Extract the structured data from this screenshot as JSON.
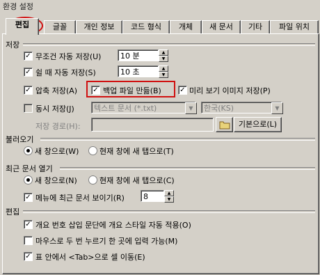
{
  "window": {
    "title": "환경 설정"
  },
  "tabs": [
    "편집",
    "글꼴",
    "개인 정보",
    "코드 형식",
    "개체",
    "새 문서",
    "기타",
    "파일 위치"
  ],
  "save": {
    "section": "저장",
    "auto_save_label": "무조건 자동 저장(U)",
    "auto_save_value": "10 분",
    "idle_save_label": "쉴 때 자동 저장(S)",
    "idle_save_value": "10 초",
    "compress_label": "압축 저장(A)",
    "backup_label": "백업 파일 만듦(B)",
    "preview_label": "미리 보기 이미지 저장(P)",
    "sync_label": "동시 저장(J)",
    "format_value": "텍스트 문서 (*.txt)",
    "lang_value": "한국(KS)",
    "path_label": "저장 경로(H):",
    "default_button": "기본으로(L)"
  },
  "open": {
    "section": "불러오기",
    "new_window": "새 창으로(W)",
    "new_tab": "현재 창에 새 탭으로(T)"
  },
  "recent": {
    "section": "최근 문서 열기",
    "new_window": "새 창으로(N)",
    "new_tab": "현재 창에 새 탭으로(C)",
    "menu_label": "메뉴에 최근 문서 보이기(R)",
    "menu_count": "8"
  },
  "edit": {
    "section": "편집",
    "auto_style": "개요 번호 삽입 문단에 개요 스타일 자동 적용(O)",
    "dblclick": "마우스로 두 번 누르기 한 곳에 입력 가능(M)",
    "tab_move": "표 안에서 <Tab>으로 셀 이동(E)"
  },
  "check_glyph": "✓",
  "spin_up": "▲",
  "spin_down": "▼",
  "accent_red": "#d01010"
}
